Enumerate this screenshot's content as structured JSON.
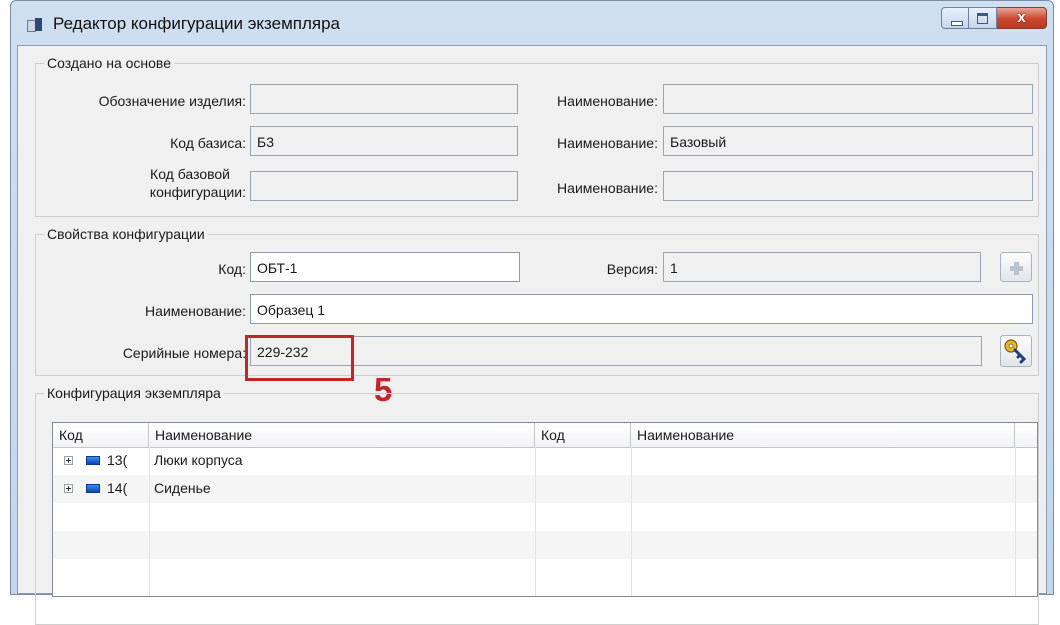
{
  "window": {
    "title": "Редактор конфигурации экземпляра",
    "close_symbol": "x"
  },
  "based_on": {
    "legend": "Создано на основе",
    "product_designation_label": "Обозначение изделия:",
    "product_designation_value": "",
    "name_label_1": "Наименование:",
    "name_value_1": "",
    "basis_code_label": "Код базиса:",
    "basis_code_value": "Б3",
    "name_label_2": "Наименование:",
    "name_value_2": "Базовый",
    "base_config_code_label_line1": "Код базовой",
    "base_config_code_label_line2": "конфигурации:",
    "base_config_code_value": "",
    "name_label_3": "Наименование:",
    "name_value_3": ""
  },
  "config_props": {
    "legend": "Свойства конфигурации",
    "code_label": "Код:",
    "code_value": "ОБТ-1",
    "version_label": "Версия:",
    "version_value": "1",
    "name_label": "Наименование:",
    "name_value": "Образец 1",
    "serials_label": "Серийные номера:",
    "serials_value": "229-232"
  },
  "annotation": {
    "step_number": "5",
    "color": "#c0262b"
  },
  "instance_config": {
    "legend": "Конфигурация экземпляра",
    "columns": [
      "Код",
      "Наименование",
      "Код",
      "Наименование"
    ],
    "rows": [
      {
        "code": "13(",
        "name": "Люки корпуса"
      },
      {
        "code": "14(",
        "name": "Сиденье"
      }
    ]
  }
}
